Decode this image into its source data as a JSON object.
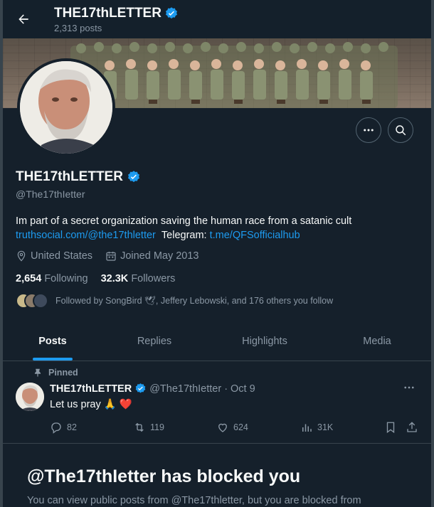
{
  "header": {
    "name": "THE17thLETTER",
    "post_count": "2,313 posts"
  },
  "profile": {
    "name": "THE17thLETTER",
    "handle": "@The17thIetter",
    "bio": "Im part of a secret organization saving the human race from a satanic cult",
    "link_text": "truthsocial.com/@the17thletter",
    "telegram_label": "Telegram:",
    "telegram_link": "t.me/QFSofficialhub",
    "location": "United States",
    "joined": "Joined May 2013",
    "following_count": "2,654",
    "following_label": "Following",
    "followers_count": "32.3K",
    "followers_label": "Followers",
    "followed_by": "Followed by SongBird 🕊, Jeffery Lebowski, and 176 others you follow"
  },
  "tabs": [
    {
      "label": "Posts"
    },
    {
      "label": "Replies"
    },
    {
      "label": "Highlights"
    },
    {
      "label": "Media"
    }
  ],
  "pinned_post": {
    "pinned_label": "Pinned",
    "author_name": "THE17thLETTER",
    "author_handle": "@The17thIetter",
    "separator": "·",
    "date": "Oct 9",
    "text": "Let us pray 🙏 ❤️",
    "replies": "82",
    "reposts": "119",
    "likes": "624",
    "views": "31K"
  },
  "blocked": {
    "title": "@The17thIetter has blocked you",
    "description": "You can view public posts from @The17thletter, but you are blocked from"
  },
  "colors": {
    "background": "#15202b",
    "accent": "#1d9bf0",
    "muted": "#8b98a5",
    "border": "#38444d"
  },
  "icons": [
    "back-arrow-icon",
    "verified-badge-icon",
    "more-icon",
    "search-icon",
    "location-icon",
    "calendar-icon",
    "pin-icon",
    "reply-icon",
    "repost-icon",
    "like-icon",
    "views-icon",
    "bookmark-icon",
    "share-icon"
  ]
}
